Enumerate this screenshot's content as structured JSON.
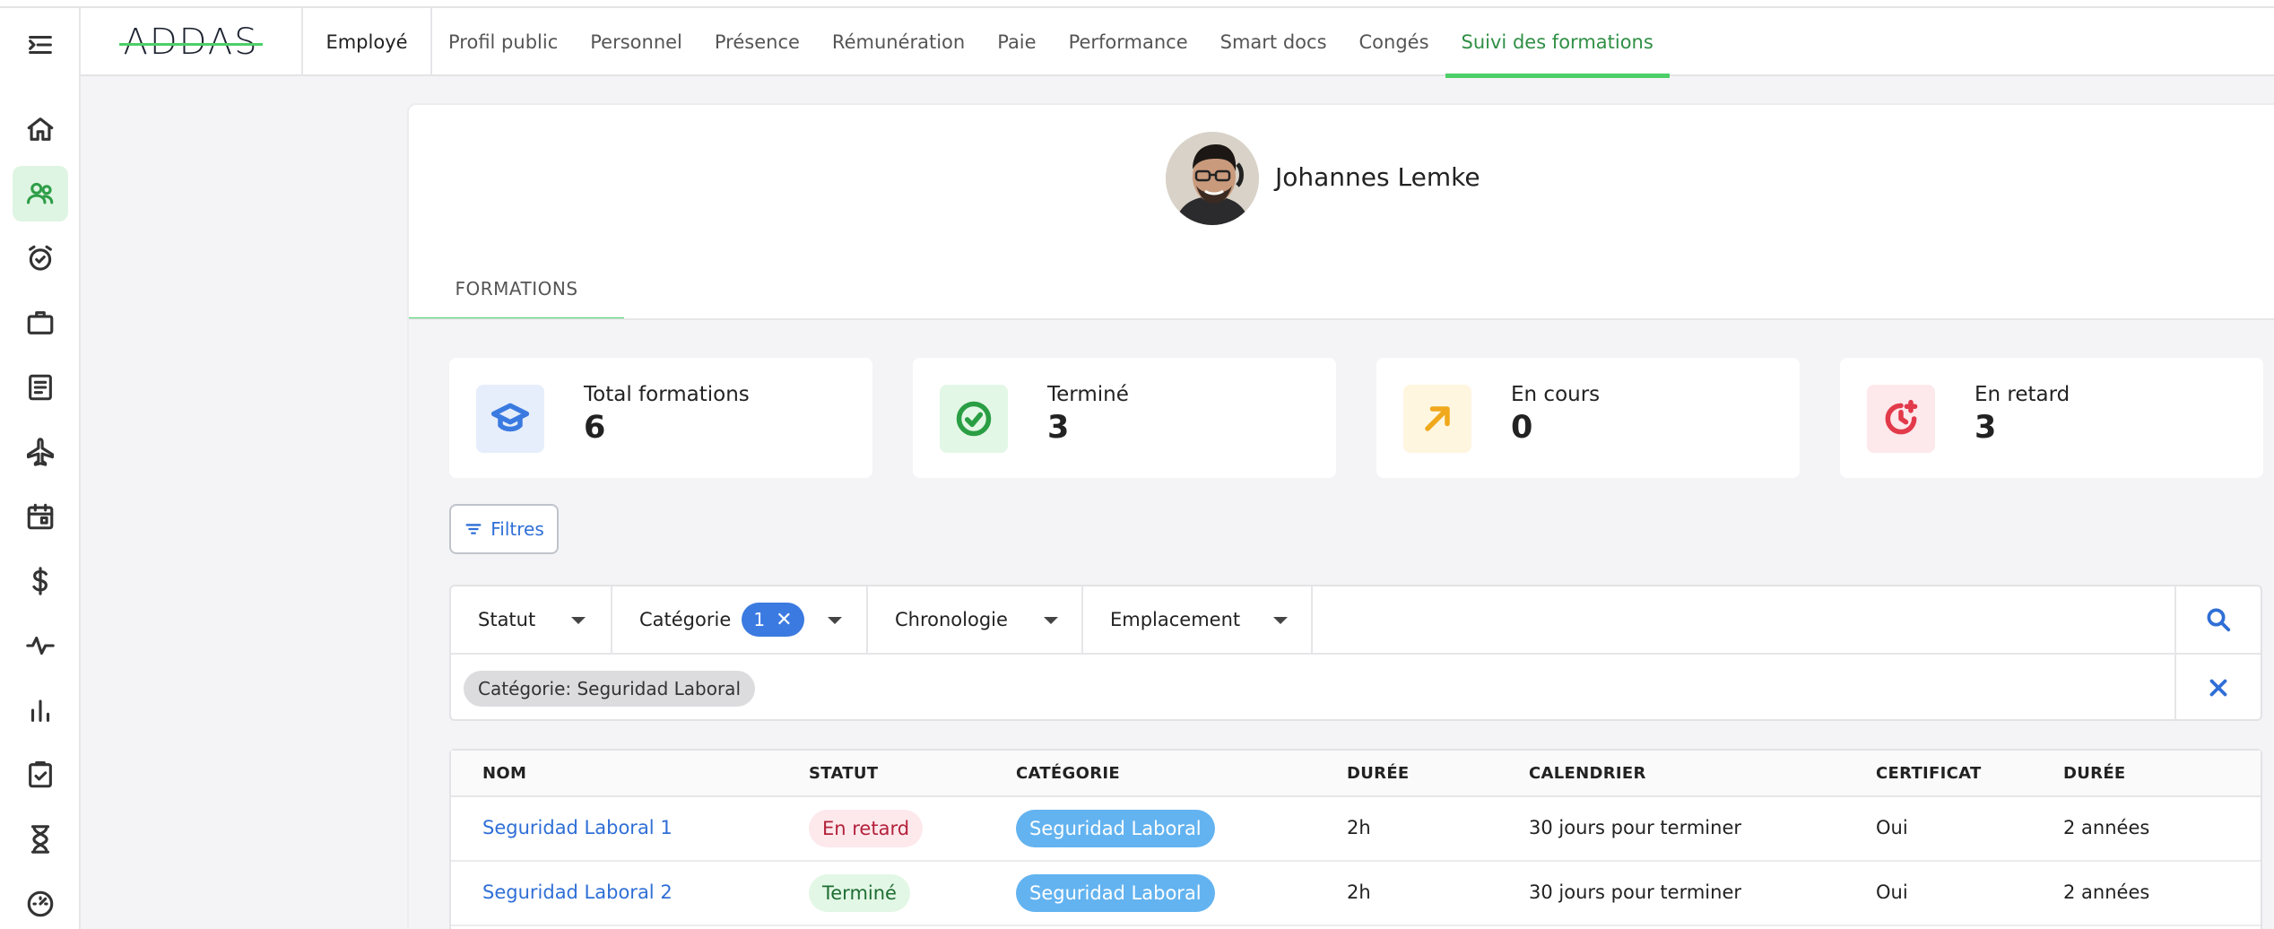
{
  "app": {
    "logo": "ADDAS",
    "section": "Employé"
  },
  "nav_tabs": [
    {
      "label": "Profil public"
    },
    {
      "label": "Personnel"
    },
    {
      "label": "Présence"
    },
    {
      "label": "Rémunération"
    },
    {
      "label": "Paie"
    },
    {
      "label": "Performance"
    },
    {
      "label": "Smart docs"
    },
    {
      "label": "Congés"
    },
    {
      "label": "Suivi des formations",
      "active": true
    }
  ],
  "sidebar": {
    "items": [
      {
        "icon": "menu-collapse-icon"
      },
      {
        "icon": "home-icon"
      },
      {
        "icon": "users-icon",
        "active": true
      },
      {
        "icon": "alarm-clock-icon"
      },
      {
        "icon": "briefcase-icon"
      },
      {
        "icon": "document-icon"
      },
      {
        "icon": "airplane-icon"
      },
      {
        "icon": "calendar-icon"
      },
      {
        "icon": "dollar-icon"
      },
      {
        "icon": "pulse-icon"
      },
      {
        "icon": "bar-chart-icon"
      },
      {
        "icon": "clipboard-check-icon"
      },
      {
        "icon": "hourglass-icon"
      },
      {
        "icon": "speedometer-icon"
      }
    ],
    "accent": "#2f9e48"
  },
  "profile": {
    "name": "Johannes Lemke",
    "subtab": "FORMATIONS"
  },
  "stats": [
    {
      "label": "Total formations",
      "value": "6",
      "icon": "graduation-cap-icon",
      "color": "#3b7ae0",
      "bg": "#e6eefb"
    },
    {
      "label": "Terminé",
      "value": "3",
      "icon": "check-circle-icon",
      "color": "#2a9e44",
      "bg": "#e3f7e6"
    },
    {
      "label": "En cours",
      "value": "0",
      "icon": "arrow-up-right-icon",
      "color": "#f0a81c",
      "bg": "#fff6e0"
    },
    {
      "label": "En retard",
      "value": "3",
      "icon": "clock-alert-icon",
      "color": "#e23a4a",
      "bg": "#fde8ec"
    }
  ],
  "filters": {
    "button_label": "Filtres",
    "dropdowns": [
      {
        "label": "Statut"
      },
      {
        "label": "Catégorie",
        "count": "1"
      },
      {
        "label": "Chronologie"
      },
      {
        "label": "Emplacement"
      }
    ],
    "active_chip": "Catégorie: Seguridad Laboral"
  },
  "table": {
    "headers": [
      "NOM",
      "STATUT",
      "CATÉGORIE",
      "DURÉE",
      "CALENDRIER",
      "CERTIFICAT",
      "DURÉE"
    ],
    "rows": [
      {
        "name": "Seguridad Laboral 1",
        "status": "En retard",
        "status_type": "late",
        "category": "Seguridad Laboral",
        "duration": "2h",
        "calendar": "30 jours pour terminer",
        "certificate": "Oui",
        "validity": "2 années"
      },
      {
        "name": "Seguridad Laboral 2",
        "status": "Terminé",
        "status_type": "done",
        "category": "Seguridad Laboral",
        "duration": "2h",
        "calendar": "30 jours pour terminer",
        "certificate": "Oui",
        "validity": "2 années"
      }
    ]
  }
}
